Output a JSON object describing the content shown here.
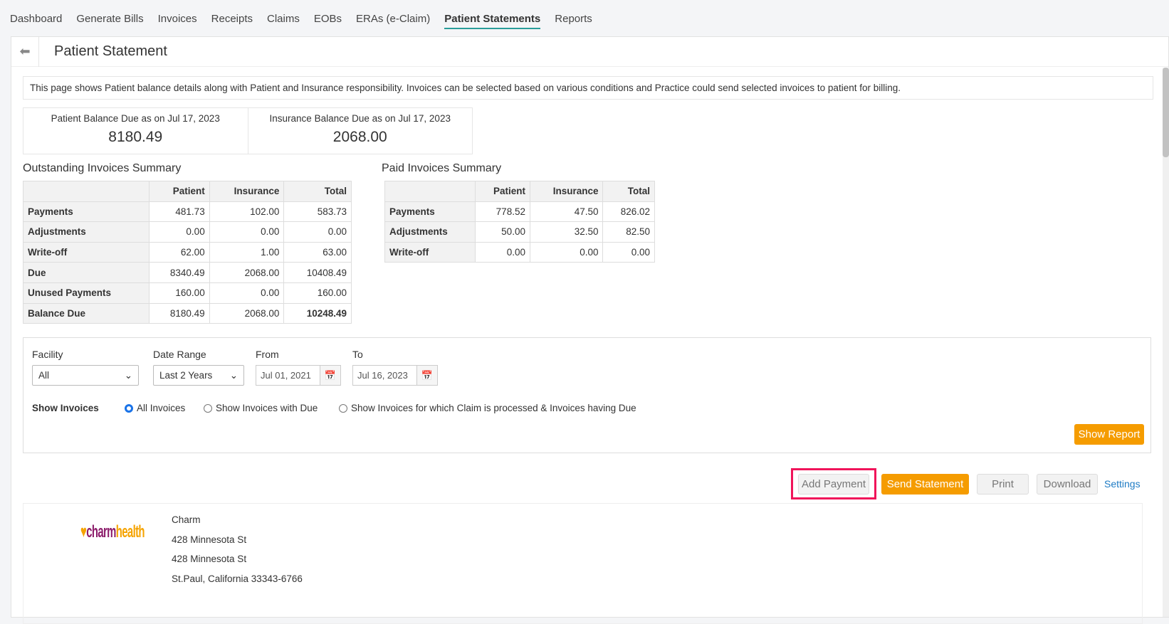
{
  "nav": [
    "Dashboard",
    "Generate Bills",
    "Invoices",
    "Receipts",
    "Claims",
    "EOBs",
    "ERAs (e-Claim)",
    "Patient Statements",
    "Reports"
  ],
  "page_title": "Patient Statement",
  "info": "This page shows Patient balance details along with Patient and Insurance responsibility. Invoices can be selected based on various conditions and Practice could send selected invoices to patient for billing.",
  "balance": {
    "patient_label": "Patient Balance Due as on Jul 17, 2023",
    "patient_value": "8180.49",
    "insurance_label": "Insurance Balance Due as on Jul 17, 2023",
    "insurance_value": "2068.00"
  },
  "outstanding": {
    "title": "Outstanding Invoices Summary",
    "headers": [
      "",
      "Patient",
      "Insurance",
      "Total"
    ],
    "rows": [
      [
        "Payments",
        "481.73",
        "102.00",
        "583.73"
      ],
      [
        "Adjustments",
        "0.00",
        "0.00",
        "0.00"
      ],
      [
        "Write-off",
        "62.00",
        "1.00",
        "63.00"
      ],
      [
        "Due",
        "8340.49",
        "2068.00",
        "10408.49"
      ],
      [
        "Unused Payments",
        "160.00",
        "0.00",
        "160.00"
      ],
      [
        "Balance Due",
        "8180.49",
        "2068.00",
        "10248.49"
      ]
    ]
  },
  "paid": {
    "title": "Paid Invoices Summary",
    "headers": [
      "",
      "Patient",
      "Insurance",
      "Total"
    ],
    "rows": [
      [
        "Payments",
        "778.52",
        "47.50",
        "826.02"
      ],
      [
        "Adjustments",
        "50.00",
        "32.50",
        "82.50"
      ],
      [
        "Write-off",
        "0.00",
        "0.00",
        "0.00"
      ]
    ]
  },
  "filters": {
    "facility_label": "Facility",
    "facility": "All",
    "range_label": "Date Range",
    "range": "Last 2 Years",
    "from_label": "From",
    "from": "Jul 01, 2021",
    "to_label": "To",
    "to": "Jul 16, 2023",
    "show_label": "Show Invoices",
    "options": [
      "All Invoices",
      "Show Invoices with Due",
      "Show Invoices for which Claim is processed & Invoices having Due"
    ],
    "show_report": "Show Report"
  },
  "actions": {
    "add_payment": "Add Payment",
    "send_statement": "Send Statement",
    "print": "Print",
    "download": "Download",
    "settings": "Settings"
  },
  "letter": {
    "logo": "charmhealth",
    "name": "Charm",
    "address1": "428 Minnesota St",
    "address2": "428 Minnesota St",
    "city": "St.Paul, California 33343-6766"
  }
}
